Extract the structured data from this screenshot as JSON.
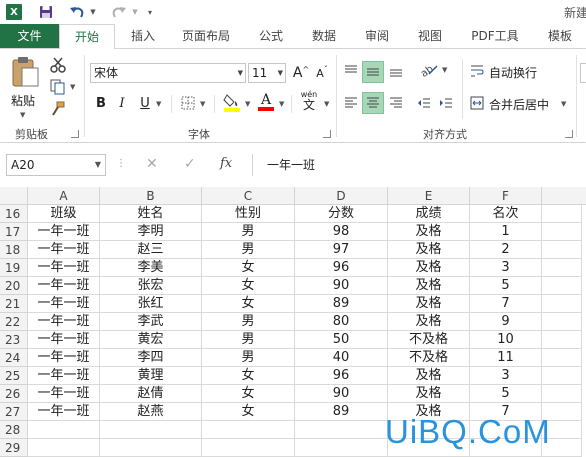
{
  "title_bar": {
    "app_icon_label": "X",
    "title_text": "新建"
  },
  "tabs": [
    {
      "label": "文件"
    },
    {
      "label": "开始"
    },
    {
      "label": "插入"
    },
    {
      "label": "页面布局"
    },
    {
      "label": "公式"
    },
    {
      "label": "数据"
    },
    {
      "label": "审阅"
    },
    {
      "label": "视图"
    },
    {
      "label": "PDF工具"
    },
    {
      "label": "模板"
    }
  ],
  "ribbon": {
    "clipboard": {
      "paste_label": "粘贴",
      "group_label": "剪贴板"
    },
    "font": {
      "font_name": "宋体",
      "font_size": "11",
      "bold": "B",
      "italic": "I",
      "underline": "U",
      "phonetic": "wén",
      "group_label": "字体",
      "fill_color": "#ffff00",
      "font_color": "#ff0000"
    },
    "alignment": {
      "wrap_text": "自动换行",
      "merge_center": "合并后居中",
      "group_label": "对齐方式"
    }
  },
  "formula_bar": {
    "name_box": "A20",
    "fx_label": "fx",
    "content": "一年一班"
  },
  "columns": [
    "A",
    "B",
    "C",
    "D",
    "E",
    "F"
  ],
  "row_numbers": [
    "16",
    "17",
    "18",
    "19",
    "20",
    "21",
    "22",
    "23",
    "24",
    "25",
    "26",
    "27",
    "28",
    "29"
  ],
  "rows": [
    [
      "班级",
      "姓名",
      "性别",
      "分数",
      "成绩",
      "名次"
    ],
    [
      "一年一班",
      "李明",
      "男",
      "98",
      "及格",
      "1"
    ],
    [
      "一年一班",
      "赵三",
      "男",
      "97",
      "及格",
      "2"
    ],
    [
      "一年一班",
      "李美",
      "女",
      "96",
      "及格",
      "3"
    ],
    [
      "一年一班",
      "张宏",
      "女",
      "90",
      "及格",
      "5"
    ],
    [
      "一年一班",
      "张红",
      "女",
      "89",
      "及格",
      "7"
    ],
    [
      "一年一班",
      "李武",
      "男",
      "80",
      "及格",
      "9"
    ],
    [
      "一年一班",
      "黄宏",
      "男",
      "50",
      "不及格",
      "10"
    ],
    [
      "一年一班",
      "李四",
      "男",
      "40",
      "不及格",
      "11"
    ],
    [
      "一年一班",
      "黄理",
      "女",
      "96",
      "及格",
      "3"
    ],
    [
      "一年一班",
      "赵倩",
      "女",
      "90",
      "及格",
      "5"
    ],
    [
      "一年一班",
      "赵燕",
      "女",
      "89",
      "及格",
      "7"
    ],
    [
      "",
      "",
      "",
      "",
      "",
      ""
    ],
    [
      "",
      "",
      "",
      "",
      "",
      ""
    ]
  ],
  "watermark": "UiBQ.CoM"
}
